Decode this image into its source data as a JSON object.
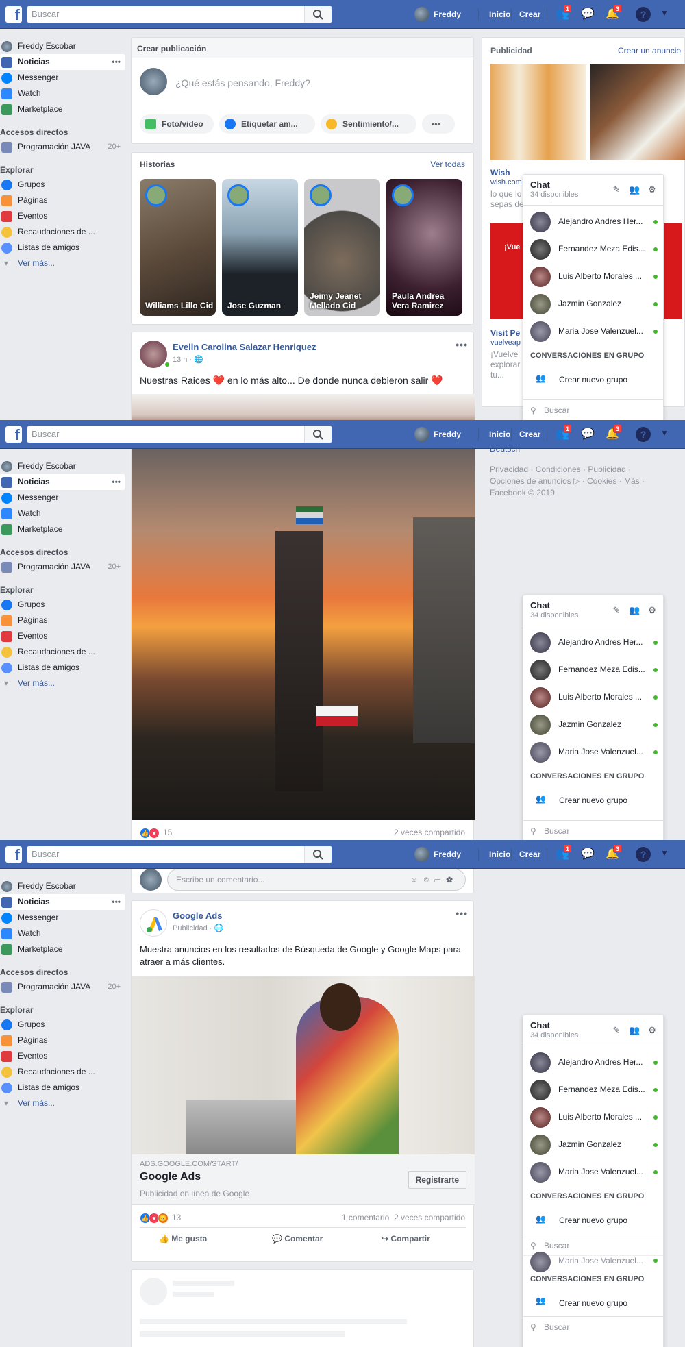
{
  "topbar": {
    "search_placeholder": "Buscar",
    "user": "Freddy",
    "home": "Inicio",
    "create": "Crear",
    "friend_badge": "1",
    "notif_badge": "3",
    "help": "?"
  },
  "leftnav": {
    "user": "Freddy Escobar",
    "items": [
      {
        "label": "Noticias"
      },
      {
        "label": "Messenger"
      },
      {
        "label": "Watch"
      },
      {
        "label": "Marketplace"
      }
    ],
    "shortcuts_title": "Accesos directos",
    "shortcut": {
      "label": "Programación JAVA",
      "count": "20+"
    },
    "explore_title": "Explorar",
    "explore": [
      {
        "label": "Grupos"
      },
      {
        "label": "Páginas"
      },
      {
        "label": "Eventos"
      },
      {
        "label": "Recaudaciones de ..."
      },
      {
        "label": "Listas de amigos"
      }
    ],
    "more": "Ver más..."
  },
  "composer": {
    "title": "Crear publicación",
    "placeholder": "¿Qué estás pensando, Freddy?",
    "photo": "Foto/video",
    "tag": "Etiquetar am...",
    "feeling": "Sentimiento/..."
  },
  "stories": {
    "title": "Historias",
    "see_all": "Ver todas",
    "items": [
      {
        "name": "Williams Lillo Cid"
      },
      {
        "name": "Jose Guzman"
      },
      {
        "name": "Jeimy Jeanet Mellado Cid"
      },
      {
        "name": "Paula Andrea Vera Ramirez"
      }
    ]
  },
  "post1": {
    "author": "Evelin Carolina Salazar Henriquez",
    "time": "13 h ·",
    "text": "Nuestras Raices ❤️ en lo más alto... De donde nunca debieron salir ❤️",
    "reactions": "15",
    "shares": "2 veces compartido"
  },
  "ads": {
    "title": "Publicidad",
    "create": "Crear un anuncio",
    "wish_name": "Wish",
    "wish_url": "wish.com",
    "wish_text1": "lo que lo",
    "wish_text2": "sepas de",
    "visit_title": "Visit Pe",
    "visit_url": "vuelveap",
    "visit_text1": "¡Vuelve",
    "visit_text2": "explorar",
    "visit_text3": "tu...",
    "ad_red": "¡Vue"
  },
  "footer": {
    "lang": "Deutsch",
    "line1": "Privacidad · Condiciones · Publicidad ·",
    "line2": "Opciones de anuncios ▷ · Cookies · Más ·",
    "line3": "Facebook © 2019"
  },
  "chat": {
    "title": "Chat",
    "available": "34 disponibles",
    "contacts": [
      {
        "name": "Alejandro Andres Her..."
      },
      {
        "name": "Fernandez Meza Edis..."
      },
      {
        "name": "Luis Alberto Morales ..."
      },
      {
        "name": "Jazmin Gonzalez"
      },
      {
        "name": "Maria Jose Valenzuel..."
      }
    ],
    "group_title": "CONVERSACIONES EN GRUPO",
    "new_group": "Crear nuevo grupo",
    "search": "Buscar",
    "partial_contact": "Maria Jose Valenzuel..."
  },
  "comment_box": {
    "placeholder": "Escribe un comentario..."
  },
  "ad_post": {
    "author": "Google Ads",
    "sponsored": "Publicidad ·",
    "text": "Muestra anuncios en los resultados de Búsqueda de Google y Google Maps para atraer a más clientes.",
    "url": "ADS.GOOGLE.COM/START/",
    "headline": "Google Ads",
    "desc": "Publicidad en línea de Google",
    "cta": "Registrarte",
    "reactions": "13",
    "comments": "1 comentario",
    "shares": "2 veces compartido",
    "like": "Me gusta",
    "comment": "Comentar",
    "share": "Compartir"
  },
  "colors": {
    "brand": "#4267b2",
    "background": "#e9ebee",
    "link": "#365899",
    "online": "#42b72a",
    "badge": "#fa3e3e"
  }
}
